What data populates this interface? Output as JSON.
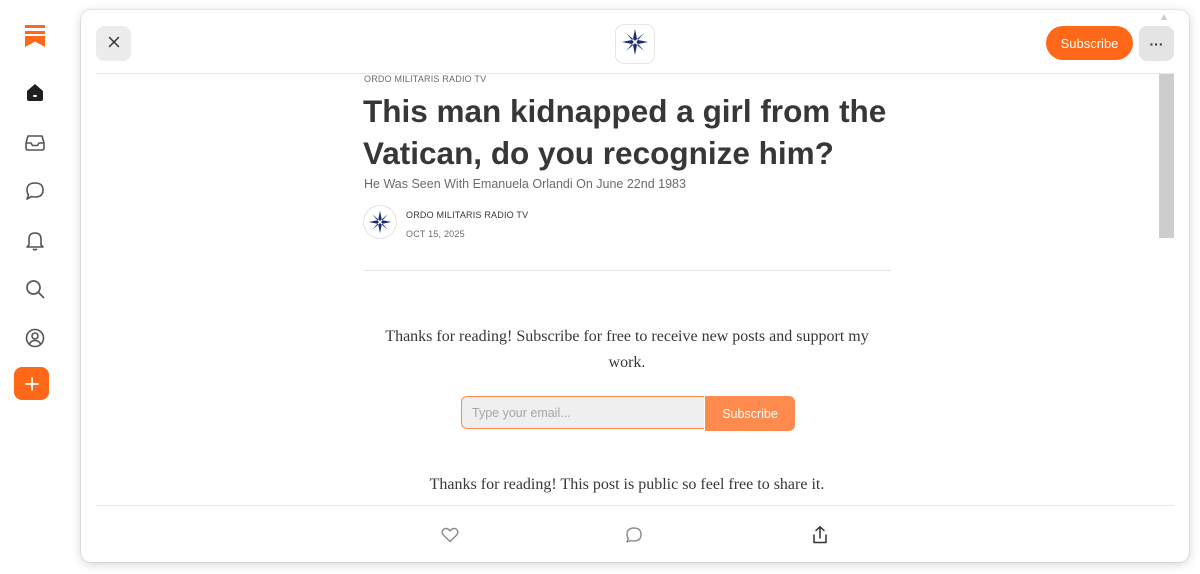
{
  "colors": {
    "accent": "#ff6719",
    "accent_light": "#ff8a4d",
    "text": "#363737",
    "muted": "#6b6b6b"
  },
  "rail": {
    "items": [
      {
        "icon": "bookmark-logo-icon"
      },
      {
        "icon": "home-icon"
      },
      {
        "icon": "inbox-icon"
      },
      {
        "icon": "chat-icon"
      },
      {
        "icon": "bell-icon"
      },
      {
        "icon": "search-icon"
      },
      {
        "icon": "profile-icon"
      },
      {
        "icon": "plus-icon"
      }
    ]
  },
  "header": {
    "close_icon": "close-icon",
    "publication_logo_icon": "star-cross-logo-icon",
    "subscribe_label": "Subscribe",
    "more_label": "···"
  },
  "post": {
    "kicker": "ORDO MILITARIS RADIO TV",
    "title": "This man kidnapped a girl from the Vatican, do you recognize him?",
    "subtitle": "He Was Seen With Emanuela Orlandi On June 22nd 1983",
    "author": "ORDO MILITARIS RADIO TV",
    "date": "OCT 15, 2025"
  },
  "subscribe_box": {
    "message": "Thanks for reading! Subscribe for free to receive new posts and support my work.",
    "email_placeholder": "Type your email...",
    "button_label": "Subscribe"
  },
  "footer_text": "Thanks for reading! This post is public so feel free to share it.",
  "actions": [
    {
      "icon": "heart-icon"
    },
    {
      "icon": "comment-icon"
    },
    {
      "icon": "share-icon"
    }
  ]
}
